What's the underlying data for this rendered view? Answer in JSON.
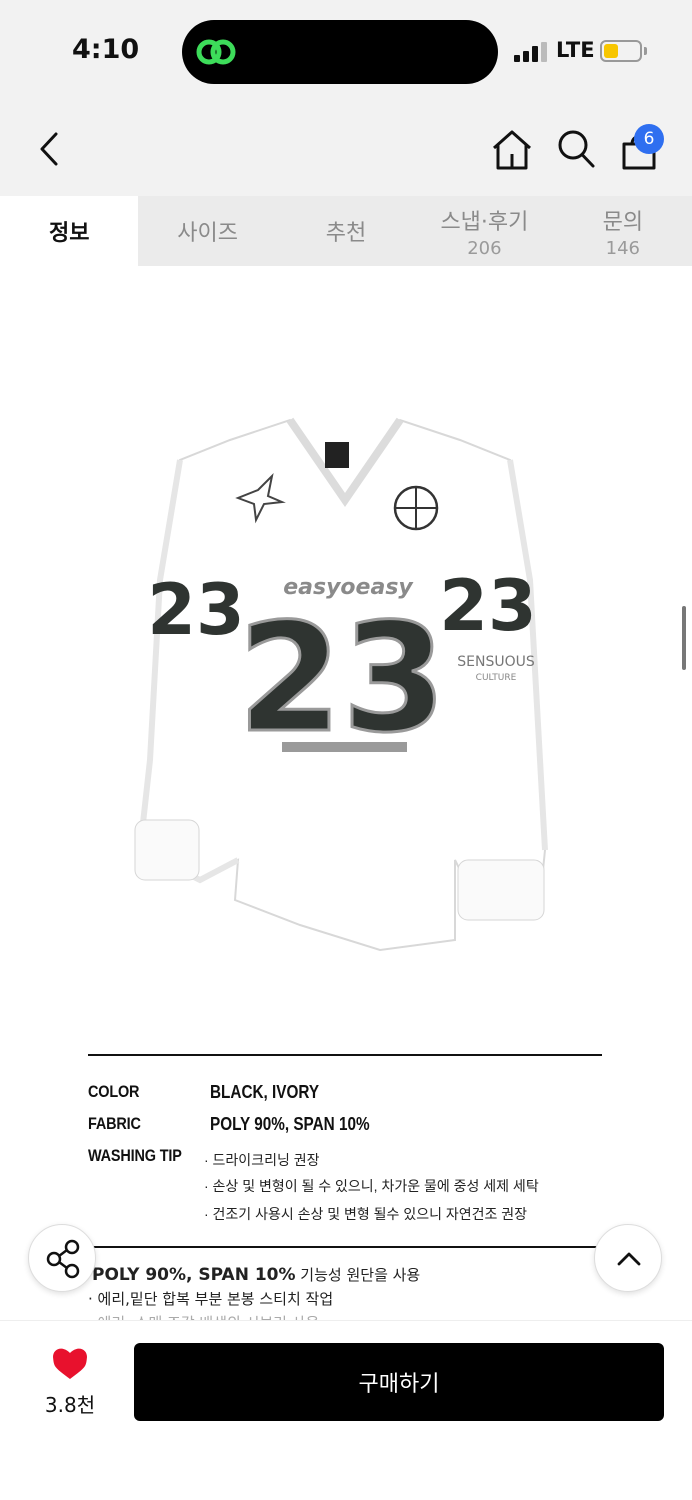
{
  "status_bar": {
    "time": "4:10",
    "network": "LTE",
    "battery_color": "#f7c600"
  },
  "header": {
    "back_icon": "chevron-left-icon",
    "home_icon": "home-icon",
    "search_icon": "search-icon",
    "bag_icon": "shopping-bag-icon",
    "bag_count": "6",
    "badge_color": "#2f6ff0"
  },
  "tabs": [
    {
      "label": "정보",
      "count": ""
    },
    {
      "label": "사이즈",
      "count": ""
    },
    {
      "label": "추천",
      "count": ""
    },
    {
      "label": "스냅·후기",
      "count": "206"
    },
    {
      "label": "문의",
      "count": "146"
    }
  ],
  "product_image": {
    "brand_text": "easyoeasy",
    "number": "23",
    "sleeve_text": "SENSUOUS",
    "sleeve_subtext": "CULTURE"
  },
  "specs": {
    "color_label": "COLOR",
    "color_value": "BLACK, IVORY",
    "fabric_label": "FABRIC",
    "fabric_value": "POLY 90%, SPAN 10%",
    "washing_label": "WASHING TIP",
    "washing_tips": [
      "· 드라이크리닝 권장",
      "· 손상 및 변형이 될 수 있으니, 차가운 물에 중성 세제 세탁",
      "· 건조기 사용시 손상 및 변형 될수 있으니 자연건조 권장"
    ]
  },
  "notes": {
    "line1_bold": "POLY 90%, SPAN 10%",
    "line1_rest": " 기능성 원단을 사용",
    "line2": "· 에리,밑단 합복 부분 본봉 스티치 작업",
    "line3": "· 에리, 소매 조각 배색의 시보리 사용"
  },
  "bottom_bar": {
    "like_count": "3.8천",
    "buy_label": "구매하기",
    "heart_color": "#e8112d"
  }
}
